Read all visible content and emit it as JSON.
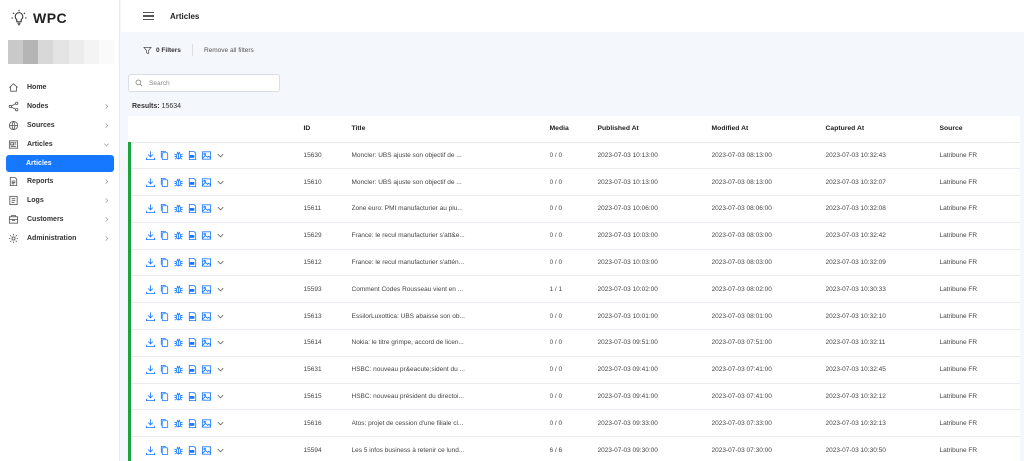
{
  "app": {
    "brand": "WPC"
  },
  "header": {
    "title": "Articles"
  },
  "filters": {
    "count_label": "0 Filters",
    "remove_label": "Remove all filters"
  },
  "search": {
    "placeholder": "Search"
  },
  "results": {
    "label": "Results:",
    "count": "15634"
  },
  "sidebar": {
    "items": [
      {
        "label": "Home",
        "icon": "home-icon"
      },
      {
        "label": "Nodes",
        "icon": "share-icon"
      },
      {
        "label": "Sources",
        "icon": "globe-icon"
      },
      {
        "label": "Articles",
        "icon": "newspaper-icon"
      },
      {
        "label": "Articles",
        "icon": "",
        "active": true
      },
      {
        "label": "Reports",
        "icon": "file-icon"
      },
      {
        "label": "Logs",
        "icon": "book-icon"
      },
      {
        "label": "Customers",
        "icon": "building-icon"
      },
      {
        "label": "Administration",
        "icon": "gear-icon"
      }
    ]
  },
  "table": {
    "columns": [
      "ID",
      "Title",
      "Media",
      "Published At",
      "Modified At",
      "Captured At",
      "Source"
    ],
    "rows": [
      {
        "id": "15630",
        "title": "Moncler: UBS ajuste son objectif de ...",
        "media": "0 / 0",
        "published": "2023-07-03 10:13:00",
        "modified": "2023-07-03 08:13:00",
        "captured": "2023-07-03 10:32:43",
        "source": "Latribune FR"
      },
      {
        "id": "15610",
        "title": "Moncler: UBS ajuste son objectif de ...",
        "media": "0 / 0",
        "published": "2023-07-03 10:13:00",
        "modified": "2023-07-03 08:13:00",
        "captured": "2023-07-03 10:32:07",
        "source": "Latribune FR"
      },
      {
        "id": "15611",
        "title": "Zone euro: PMI manufacturier au plu...",
        "media": "0 / 0",
        "published": "2023-07-03 10:06:00",
        "modified": "2023-07-03 08:06:00",
        "captured": "2023-07-03 10:32:08",
        "source": "Latribune FR"
      },
      {
        "id": "15629",
        "title": "France: le recul manufacturier s'att&e...",
        "media": "0 / 0",
        "published": "2023-07-03 10:03:00",
        "modified": "2023-07-03 08:03:00",
        "captured": "2023-07-03 10:32:42",
        "source": "Latribune FR"
      },
      {
        "id": "15612",
        "title": "France: le recul manufacturier s'attén...",
        "media": "0 / 0",
        "published": "2023-07-03 10:03:00",
        "modified": "2023-07-03 08:03:00",
        "captured": "2023-07-03 10:32:09",
        "source": "Latribune FR"
      },
      {
        "id": "15593",
        "title": "Comment Codes Rousseau vient en ...",
        "media": "1 / 1",
        "published": "2023-07-03 10:02:00",
        "modified": "2023-07-03 08:02:00",
        "captured": "2023-07-03 10:30:33",
        "source": "Latribune FR"
      },
      {
        "id": "15613",
        "title": "EssilorLuxottica: UBS abaisse son ob...",
        "media": "0 / 0",
        "published": "2023-07-03 10:01:00",
        "modified": "2023-07-03 08:01:00",
        "captured": "2023-07-03 10:32:10",
        "source": "Latribune FR"
      },
      {
        "id": "15614",
        "title": "Nokia: le titre grimpe, accord de licen...",
        "media": "0 / 0",
        "published": "2023-07-03 09:51:00",
        "modified": "2023-07-03 07:51:00",
        "captured": "2023-07-03 10:32:11",
        "source": "Latribune FR"
      },
      {
        "id": "15631",
        "title": "HSBC: nouveau pr&eacute;sident du ...",
        "media": "0 / 0",
        "published": "2023-07-03 09:41:00",
        "modified": "2023-07-03 07:41:00",
        "captured": "2023-07-03 10:32:45",
        "source": "Latribune FR"
      },
      {
        "id": "15615",
        "title": "HSBC: nouveau président du directoi...",
        "media": "0 / 0",
        "published": "2023-07-03 09:41:00",
        "modified": "2023-07-03 07:41:00",
        "captured": "2023-07-03 10:32:12",
        "source": "Latribune FR"
      },
      {
        "id": "15616",
        "title": "Atos: projet de cession d'une filiale cl...",
        "media": "0 / 0",
        "published": "2023-07-03 09:33:00",
        "modified": "2023-07-03 07:33:00",
        "captured": "2023-07-03 10:32:13",
        "source": "Latribune FR"
      },
      {
        "id": "15594",
        "title": "Les 5 infos business à retenir ce lund...",
        "media": "6 / 6",
        "published": "2023-07-03 09:30:00",
        "modified": "2023-07-03 07:30:00",
        "captured": "2023-07-03 10:30:50",
        "source": "Latribune FR"
      }
    ]
  },
  "colors": {
    "accent": "#1677ff",
    "status_bar": "#1aa33a",
    "icon": "#1677ff"
  }
}
